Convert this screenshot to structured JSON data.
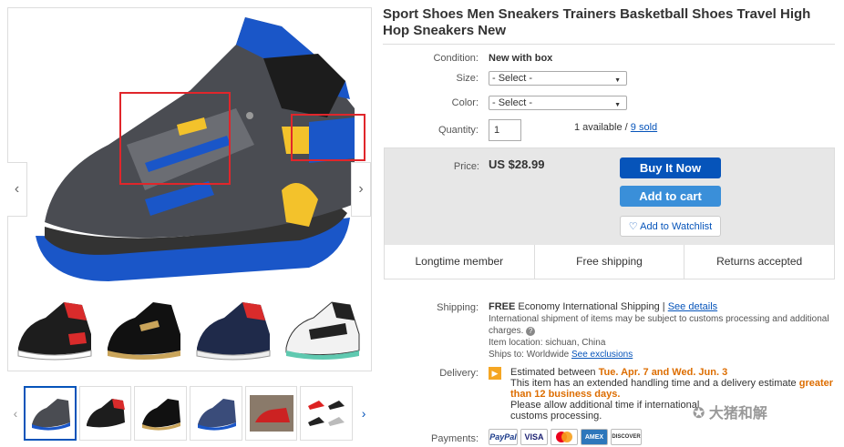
{
  "title": "Sport Shoes Men Sneakers Trainers Basketball Shoes Travel High Hop Sneakers New",
  "details": {
    "condition_label": "Condition:",
    "condition_value": "New with box",
    "size_label": "Size:",
    "size_placeholder": "- Select -",
    "color_label": "Color:",
    "color_placeholder": "- Select -",
    "quantity_label": "Quantity:",
    "quantity_value": "1",
    "available_text": "1 available /",
    "sold_text": "9 sold"
  },
  "buybox": {
    "price_label": "Price:",
    "price": "US $28.99",
    "buy_now": "Buy It Now",
    "add_to_cart": "Add to cart",
    "watchlist": "Add to Watchlist",
    "features": [
      "Longtime member",
      "Free shipping",
      "Returns accepted"
    ]
  },
  "shipping": {
    "label": "Shipping:",
    "free": "FREE",
    "method": "Economy International Shipping |",
    "see_details": "See details",
    "note": "International shipment of items may be subject to customs processing and additional charges.",
    "item_location": "Item location: sichuan, China",
    "ships_to": "Ships to: Worldwide",
    "see_exclusions": "See exclusions"
  },
  "delivery": {
    "label": "Delivery:",
    "estimated": "Estimated between",
    "dates": "Tue. Apr. 7 and Wed. Jun. 3",
    "line2": "This item has an extended handling time and a delivery estimate",
    "greater": "greater than 12 business days.",
    "line3": "Please allow additional time if international",
    "line3b": "customs processing."
  },
  "payments": {
    "label": "Payments:",
    "methods": [
      "PayPal",
      "VISA",
      "MC",
      "AMEX",
      "DISCOVER"
    ]
  },
  "watermark": "大猪和解",
  "colors": {
    "primary_blue": "#0654ba",
    "accent_orange": "#dd6d00",
    "highlight_red": "#e0262b"
  }
}
